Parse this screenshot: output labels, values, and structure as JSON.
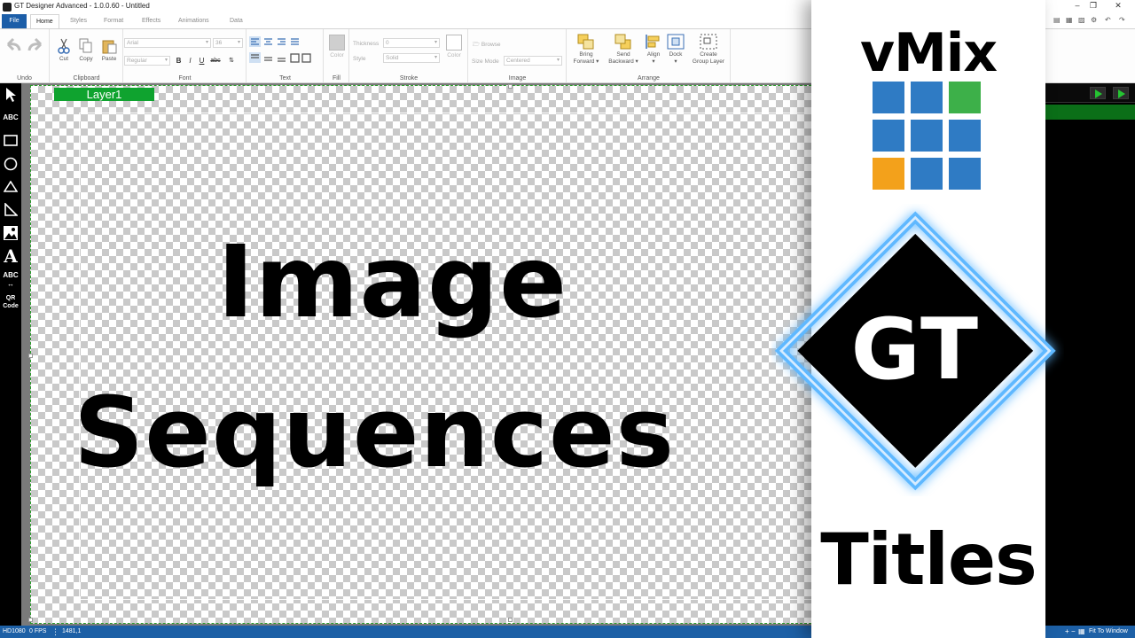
{
  "window": {
    "title": "GT Designer Advanced - 1.0.0.60 - Untitled"
  },
  "tabs": [
    "File",
    "Home",
    "Styles",
    "Format",
    "Effects",
    "Animations",
    "Data"
  ],
  "ribbon": {
    "undo": {
      "group": "Undo"
    },
    "clipboard": {
      "group": "Clipboard",
      "cut": "Cut",
      "copy": "Copy",
      "paste": "Paste"
    },
    "font": {
      "group": "Font",
      "family": "Arial",
      "size": "36",
      "style": "Regular",
      "bold": "B",
      "italic": "I",
      "underline": "U",
      "strike": "abc"
    },
    "text": {
      "group": "Text"
    },
    "fill": {
      "group": "Fill",
      "color": "Color"
    },
    "stroke": {
      "group": "Stroke",
      "thickness_label": "Thickness",
      "thickness_value": "0",
      "style_label": "Style",
      "style_value": "Solid",
      "color": "Color"
    },
    "image": {
      "group": "Image",
      "browse": "Browse",
      "size_mode_label": "Size Mode",
      "size_mode_value": "Centered"
    },
    "arrange": {
      "group": "Arrange",
      "bring_forward_1": "Bring",
      "bring_forward_2": "Forward",
      "send_backward_1": "Send",
      "send_backward_2": "Backward",
      "align": "Align",
      "dock": "Dock",
      "create_group_1": "Create",
      "create_group_2": "Group Layer"
    }
  },
  "toolbox": {
    "text_tool": "ABC",
    "ticker_tool": "ABC",
    "qr_1": "QR",
    "qr_2": "Code",
    "font_tool": "A"
  },
  "canvas": {
    "layer_name": "Layer1",
    "line1": "Image",
    "line2": "Sequences"
  },
  "statusbar": {
    "format": "HD1080",
    "fps": "0 FPS",
    "coords": "1481,1",
    "fit": "Fit To Window"
  },
  "brand": {
    "vmix": "vMix",
    "gt": "GT",
    "titles": "Titles"
  },
  "colors": {
    "accent": "#1c5ea8",
    "layer_tag": "#0fa32f",
    "vmix_blue": "#2f7bc4",
    "vmix_green": "#3db049",
    "vmix_orange": "#f3a11b",
    "glow": "#5fb8ff"
  },
  "icons": [
    "undo-icon",
    "redo-icon",
    "cut-icon",
    "copy-icon",
    "paste-icon",
    "pointer-icon",
    "rectangle-icon",
    "ellipse-icon",
    "triangle-icon",
    "line-icon",
    "image-icon",
    "play-icon"
  ]
}
